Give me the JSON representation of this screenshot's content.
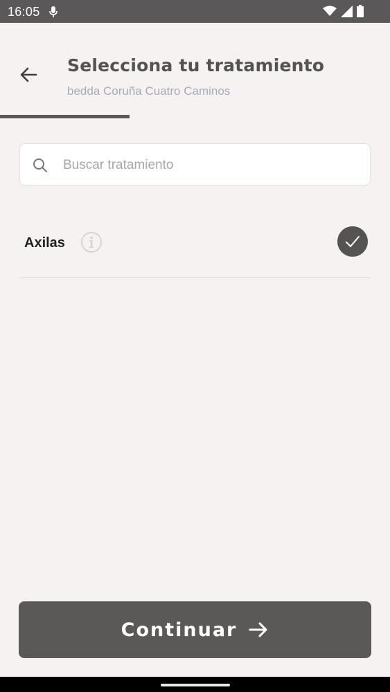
{
  "status_bar": {
    "time": "16:05"
  },
  "header": {
    "title": "Selecciona tu tratamiento",
    "subtitle": "bedda Coruña Cuatro Caminos"
  },
  "progress": {
    "fraction": 0.333
  },
  "search": {
    "placeholder": "Buscar tratamiento",
    "value": ""
  },
  "treatments": [
    {
      "label": "Axilas",
      "selected": true
    }
  ],
  "footer": {
    "continue_label": "Continuar"
  },
  "colors": {
    "primary": "#5b5858",
    "background": "#f6f2f1",
    "subtitle": "#a7a9bc"
  }
}
